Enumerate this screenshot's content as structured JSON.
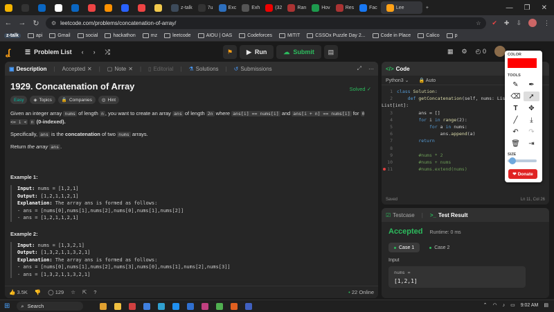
{
  "browser": {
    "tabs": [
      {
        "label": "",
        "color": "#f4b400"
      },
      {
        "label": "",
        "color": "#333333"
      },
      {
        "label": "",
        "color": "#0a66c2"
      },
      {
        "label": "",
        "color": "#ffffff"
      },
      {
        "label": "",
        "color": "#0a66c2"
      },
      {
        "label": "",
        "color": "#e44"
      },
      {
        "label": "",
        "color": "#ff9100"
      },
      {
        "label": "",
        "color": "#2962ff"
      },
      {
        "label": "",
        "color": "#e44"
      },
      {
        "label": "",
        "color": "#f2c94c"
      },
      {
        "label": "z-talk",
        "color": "#3c4a5a"
      },
      {
        "label": "7u",
        "color": "#333333"
      },
      {
        "label": "Exc",
        "color": "#2d6fbd"
      },
      {
        "label": "Exh",
        "color": "#555555"
      },
      {
        "label": "(32",
        "color": "#e00"
      },
      {
        "label": "Ran",
        "color": "#aa3333"
      },
      {
        "label": "Hov",
        "color": "#1d9a4d"
      },
      {
        "label": "Res",
        "color": "#aa3333"
      },
      {
        "label": "Fac",
        "color": "#1877f2"
      },
      {
        "label": "Lee",
        "color": "#ffa116"
      }
    ],
    "url": "leetcode.com/problems/concatenation-of-array/",
    "bookmarks": [
      "z-talk",
      "api",
      "Gmail",
      "social",
      "hackathon",
      "mz",
      "leetcode",
      "AIOU | OAS",
      "Codeforces",
      "MITIT",
      "CSSOx Puzzle Day 2...",
      "Code in Place",
      "Calico",
      "p"
    ]
  },
  "lc": {
    "problem_list": "Problem List",
    "run": "Run",
    "submit": "Submit",
    "coins": "0"
  },
  "desc": {
    "tabs": [
      "Description",
      "Accepted",
      "Note",
      "Editorial",
      "Solutions",
      "Submissions"
    ],
    "title": "1929. Concatenation of Array",
    "solved": "Solved",
    "chips": [
      "Easy",
      "Topics",
      "Companies",
      "Hint"
    ],
    "p1_a": "Given an integer array",
    "p1_code1": "nums",
    "p1_b": "of length",
    "p1_code2": "n",
    "p1_c": ", you want to create an array",
    "p1_code3": "ans",
    "p1_d": "of length",
    "p1_code4": "2n",
    "p1_e": "where",
    "p1_code5": "ans[i] == nums[i]",
    "p1_f": "and",
    "p1_code6": "ans[i + n] == nums[i]",
    "p1_g": "for",
    "p1_code7": "0 <= i <",
    "p1_code8": "n",
    "p1_h": "(0-indexed).",
    "p2_a": "Specifically,",
    "p2_code1": "ans",
    "p2_b": "is the",
    "p2_bold": "concatenation",
    "p2_c": "of two",
    "p2_code2": "nums",
    "p2_d": "arrays.",
    "p3_a": "Return",
    "p3_em": "the array",
    "p3_code": "ans",
    "p3_b": ".",
    "ex1_title": "Example 1:",
    "ex1_input": "nums = [1,2,1]",
    "ex1_output": "[1,2,1,1,2,1]",
    "ex1_expl": "The array ans is formed as follows:",
    "ex1_l1": "- ans = [nums[0],nums[1],nums[2],nums[0],nums[1],nums[2]]",
    "ex1_l2": "- ans = [1,2,1,1,2,1]",
    "ex2_title": "Example 2:",
    "ex2_input": "nums = [1,3,2,1]",
    "ex2_output": "[1,3,2,1,1,3,2,1]",
    "ex2_expl": "The array ans is formed as follows:",
    "ex2_l1": "- ans = [nums[0],nums[1],nums[2],nums[3],nums[0],nums[1],nums[2],nums[3]]",
    "ex2_l2": "- ans = [1,3,2,1,1,3,2,1]",
    "labels": {
      "input": "Input:",
      "output": "Output:",
      "explanation": "Explanation:"
    },
    "likes": "3.5K",
    "comments": "129",
    "online": "22 Online"
  },
  "code": {
    "title": "Code",
    "language": "Python3",
    "mode": "Auto",
    "saved": "Saved",
    "cursor": "Ln 11, Col 26"
  },
  "test": {
    "tabs": [
      "Testcase",
      "Test Result"
    ],
    "status": "Accepted",
    "runtime": "Runtime: 0 ms",
    "cases": [
      "Case 1",
      "Case 2"
    ],
    "input_label": "Input",
    "var": "nums =",
    "value": "[1,2,1]"
  },
  "anno": {
    "color_label": "COLOR",
    "tools_label": "TOOLS",
    "size_label": "SIZE",
    "color": "#ff0000",
    "donate": "Donate"
  },
  "taskbar": {
    "search": "Search",
    "time": "9:02 AM"
  }
}
